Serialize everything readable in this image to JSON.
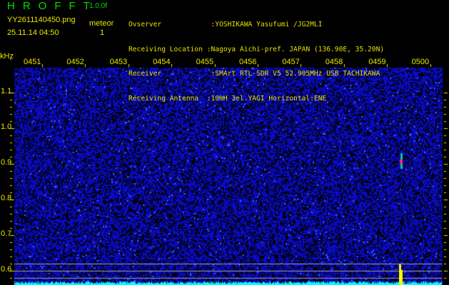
{
  "header": {
    "app_name": "HROFFT",
    "version": "1.0.0f",
    "filename": "YY2611140450.png",
    "datetime": "25.11.14 04:50",
    "meteor_label": "meteor",
    "meteor_count": "1"
  },
  "info": [
    {
      "label": "Ovserver            ",
      "value": ":YOSHIKAWA Yasufumi /JG2MLI"
    },
    {
      "label": "Receiving Location ",
      "value": ":Nagoya Aichi-pref. JAPAN (136.90E, 35.20N)"
    },
    {
      "label": "Receiver            ",
      "value": ":SMArt RTL-SDR V5 52.905MHz USB TACHIKAWA"
    },
    {
      "label": "Receiving Antenna  ",
      "value": ":10mH 3el.YAGI Horizontal:ENE"
    }
  ],
  "axis": {
    "unit": "kHz",
    "time_labels": [
      "0451",
      "0452",
      "0453",
      "0454",
      "0455",
      "0456",
      "0457",
      "0458",
      "0459",
      "0500"
    ],
    "freq_labels": [
      "1.1",
      "1.0",
      "0.9",
      "0.8",
      "0.7",
      "0.6"
    ]
  },
  "colors": {
    "text": "#e8e800",
    "logo": "#00e000",
    "noise": "#1010c0",
    "baseline": "#00ffff"
  }
}
